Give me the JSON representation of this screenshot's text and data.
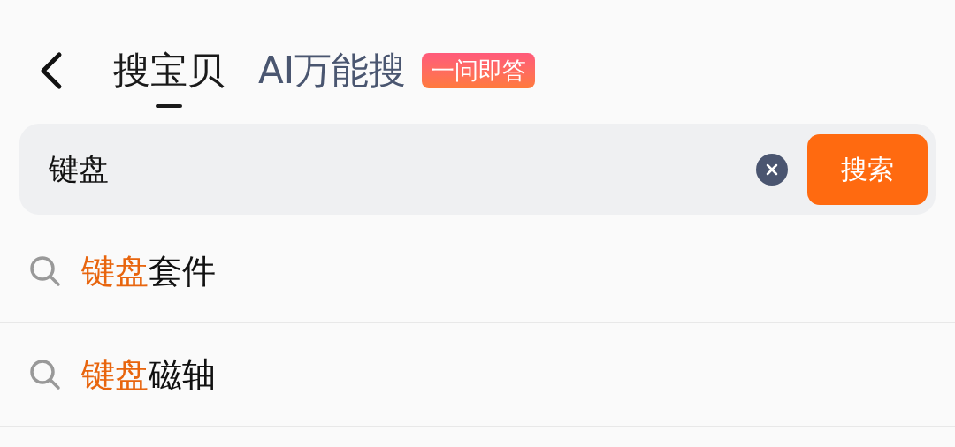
{
  "tabs": [
    {
      "label": "搜宝贝",
      "selected": true
    },
    {
      "label": "AI万能搜",
      "selected": false,
      "badge": "一问即答"
    }
  ],
  "search": {
    "value": "键盘",
    "button": "搜索"
  },
  "suggestions": [
    {
      "match": "键盘",
      "rest": "套件"
    },
    {
      "match": "键盘",
      "rest": "磁轴"
    }
  ]
}
